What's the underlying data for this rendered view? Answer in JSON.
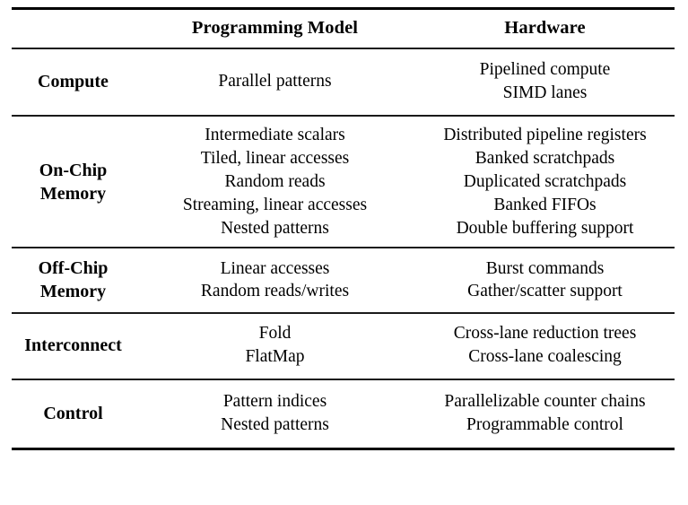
{
  "table": {
    "columns": [
      {
        "id": "category",
        "label": ""
      },
      {
        "id": "programming_model",
        "label": "Programming Model"
      },
      {
        "id": "hardware",
        "label": "Hardware"
      }
    ],
    "rows": [
      {
        "id": "compute",
        "label": "Compute",
        "programming_model": [
          "Parallel patterns"
        ],
        "hardware": [
          "Pipelined compute",
          "SIMD lanes"
        ]
      },
      {
        "id": "on-chip-memory",
        "label": "On-Chip\nMemory",
        "programming_model": [
          "Intermediate scalars",
          "Tiled, linear accesses",
          "Random reads",
          "Streaming, linear accesses",
          "Nested patterns"
        ],
        "hardware": [
          "Distributed pipeline registers",
          "Banked scratchpads",
          "Duplicated scratchpads",
          "Banked FIFOs",
          "Double buffering support"
        ]
      },
      {
        "id": "off-chip-memory",
        "label": "Off-Chip\nMemory",
        "programming_model": [
          "Linear accesses",
          "Random reads/writes"
        ],
        "hardware": [
          "Burst commands",
          "Gather/scatter support"
        ]
      },
      {
        "id": "interconnect",
        "label": "Interconnect",
        "programming_model": [
          "Fold",
          "FlatMap"
        ],
        "hardware": [
          "Cross-lane reduction trees",
          "Cross-lane coalescing"
        ]
      },
      {
        "id": "control",
        "label": "Control",
        "programming_model": [
          "Pattern indices",
          "Nested patterns"
        ],
        "hardware": [
          "Parallelizable counter chains",
          "Programmable control"
        ]
      }
    ]
  },
  "style": {
    "text_color": "#000000",
    "rule_color": "#000000",
    "background": "#ffffff"
  }
}
